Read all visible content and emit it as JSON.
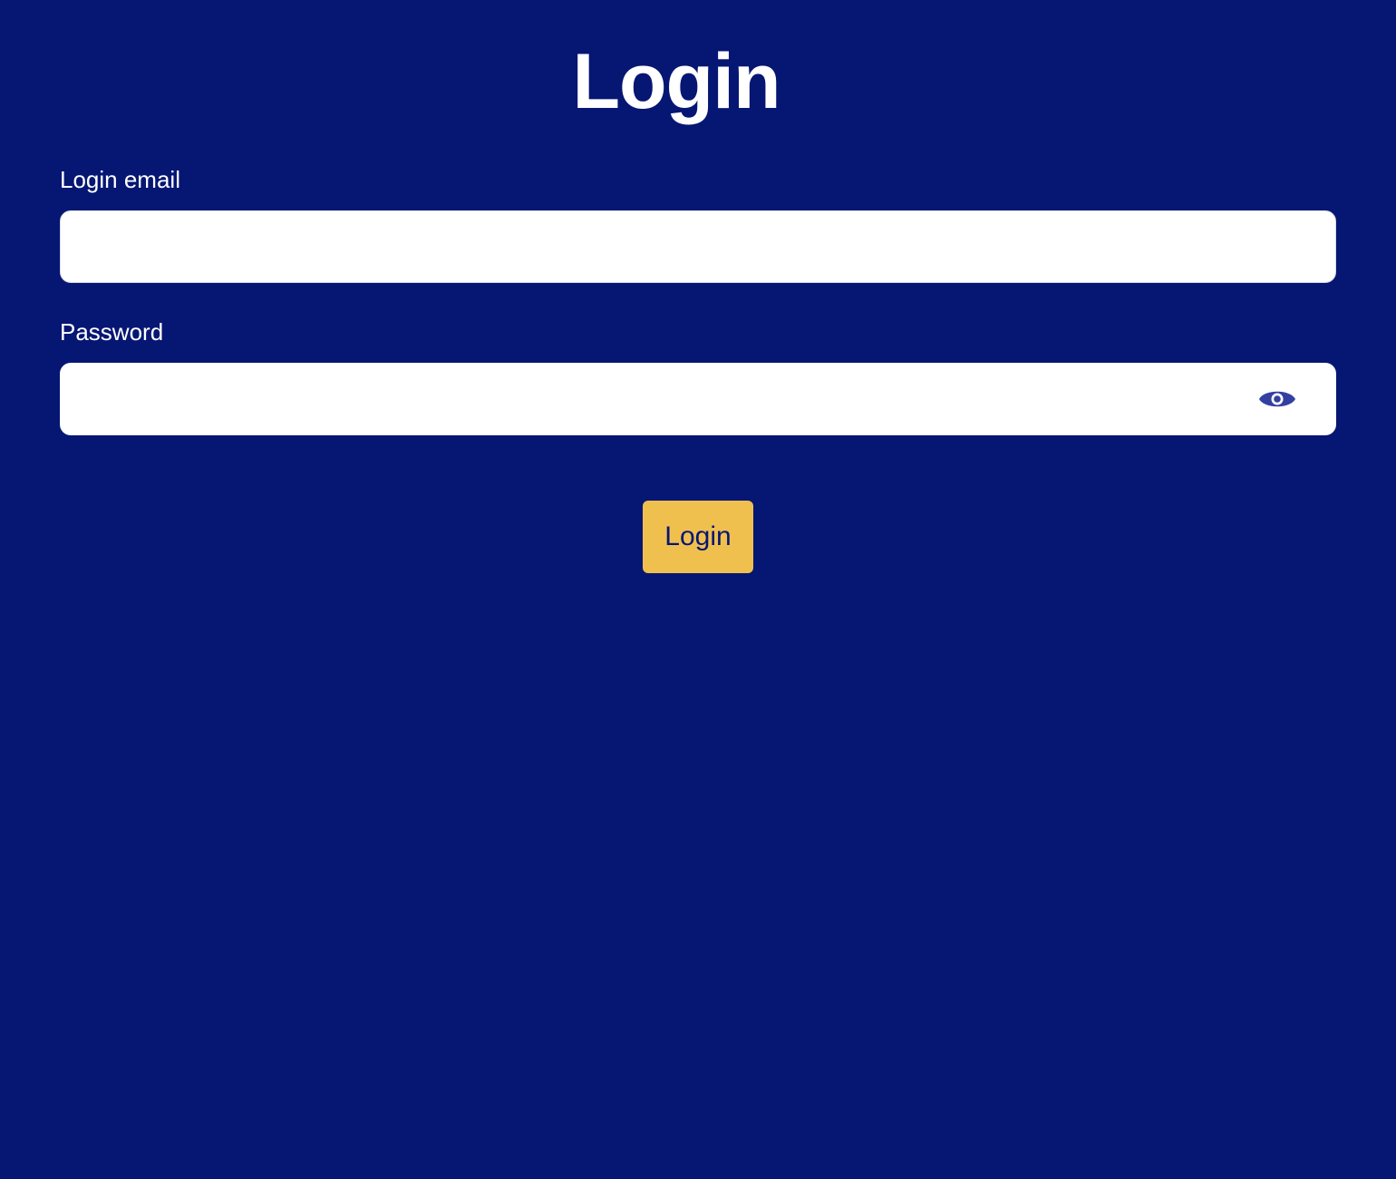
{
  "page": {
    "title": "Login"
  },
  "form": {
    "email": {
      "label": "Login email",
      "value": "",
      "placeholder": ""
    },
    "password": {
      "label": "Password",
      "value": "",
      "placeholder": "",
      "toggle_icon": "eye-icon"
    },
    "submit_label": "Login"
  },
  "colors": {
    "background": "#061673",
    "button": "#F0C04F",
    "button_text": "#061673",
    "icon": "#3440A1",
    "text": "#FFFFFF",
    "input_background": "#FFFFFF"
  }
}
